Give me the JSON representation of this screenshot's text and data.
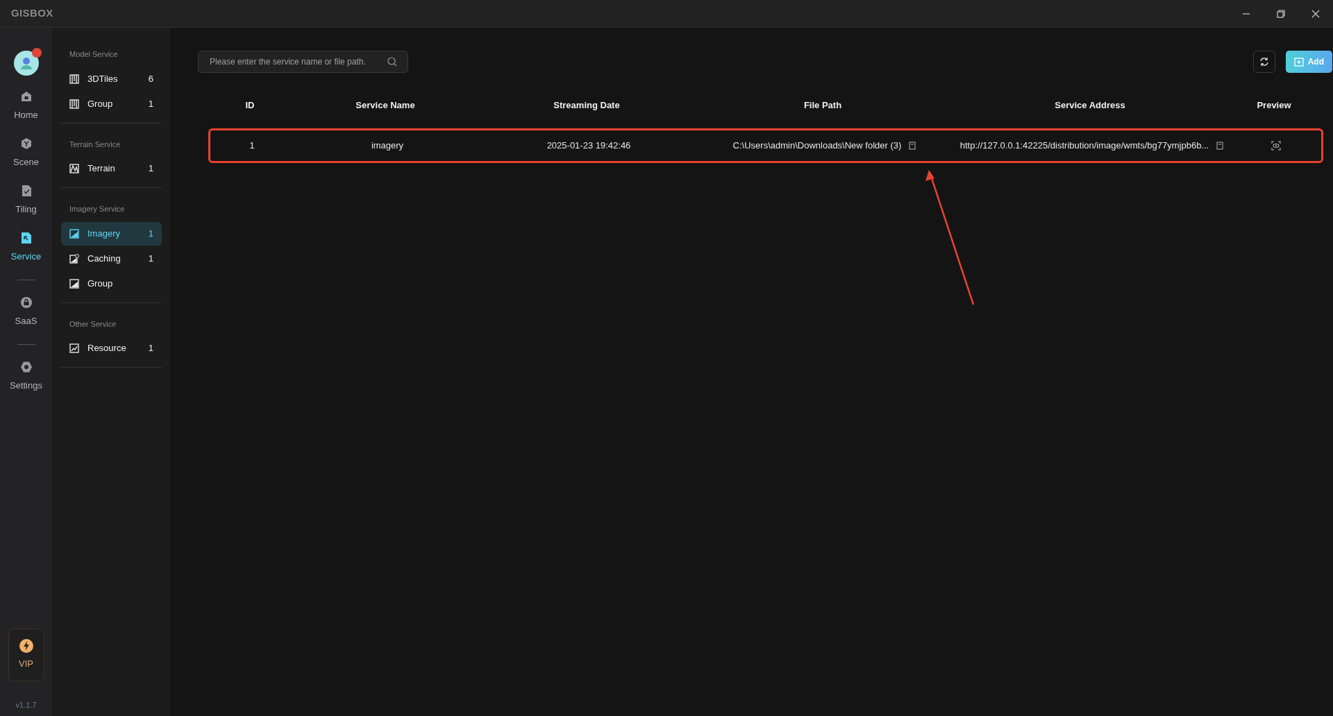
{
  "app": {
    "logo": "GISBOX",
    "version": "v1.1.7",
    "vip": "VIP"
  },
  "rail": [
    {
      "label": "Home",
      "kind": "home",
      "selected": false
    },
    {
      "label": "Scene",
      "kind": "scene",
      "selected": false
    },
    {
      "label": "Tiling",
      "kind": "tiling",
      "selected": false
    },
    {
      "label": "Service",
      "kind": "service",
      "selected": true
    },
    {
      "label": "SaaS",
      "kind": "saas",
      "selected": false,
      "divider_before": true
    },
    {
      "label": "Settings",
      "kind": "settings",
      "selected": false,
      "divider_before": true
    }
  ],
  "sidebar": [
    {
      "title": "Model Service",
      "items": [
        {
          "label": "3DTiles",
          "count": "6",
          "kind": "tiles",
          "selected": false
        },
        {
          "label": "Group",
          "count": "1",
          "kind": "tiles",
          "selected": false
        }
      ]
    },
    {
      "title": "Terrain Service",
      "items": [
        {
          "label": "Terrain",
          "count": "1",
          "kind": "terrain",
          "selected": false
        }
      ]
    },
    {
      "title": "Imagery Service",
      "items": [
        {
          "label": "Imagery",
          "count": "1",
          "kind": "imagery",
          "selected": true
        },
        {
          "label": "Caching",
          "count": "1",
          "kind": "caching",
          "selected": false
        },
        {
          "label": "Group",
          "kind": "imagery",
          "selected": false
        }
      ]
    },
    {
      "title": "Other Service",
      "items": [
        {
          "label": "Resource",
          "count": "1",
          "kind": "resource",
          "selected": false
        }
      ]
    }
  ],
  "search": {
    "placeholder": "Please enter the service name or file path."
  },
  "toolbar": {
    "add": "Add"
  },
  "table": {
    "columns": [
      "ID",
      "Service Name",
      "Streaming Date",
      "File Path",
      "Service Address",
      "Preview"
    ],
    "rows": [
      {
        "id": "1",
        "name": "imagery",
        "date": "2025-01-23 19:42:46",
        "path": "C:\\Users\\admin\\Downloads\\New folder (3)",
        "address": "http://127.0.0.1:42225/distribution/image/wmts/bg77ymjpb6b...",
        "highlighted": true
      }
    ]
  }
}
